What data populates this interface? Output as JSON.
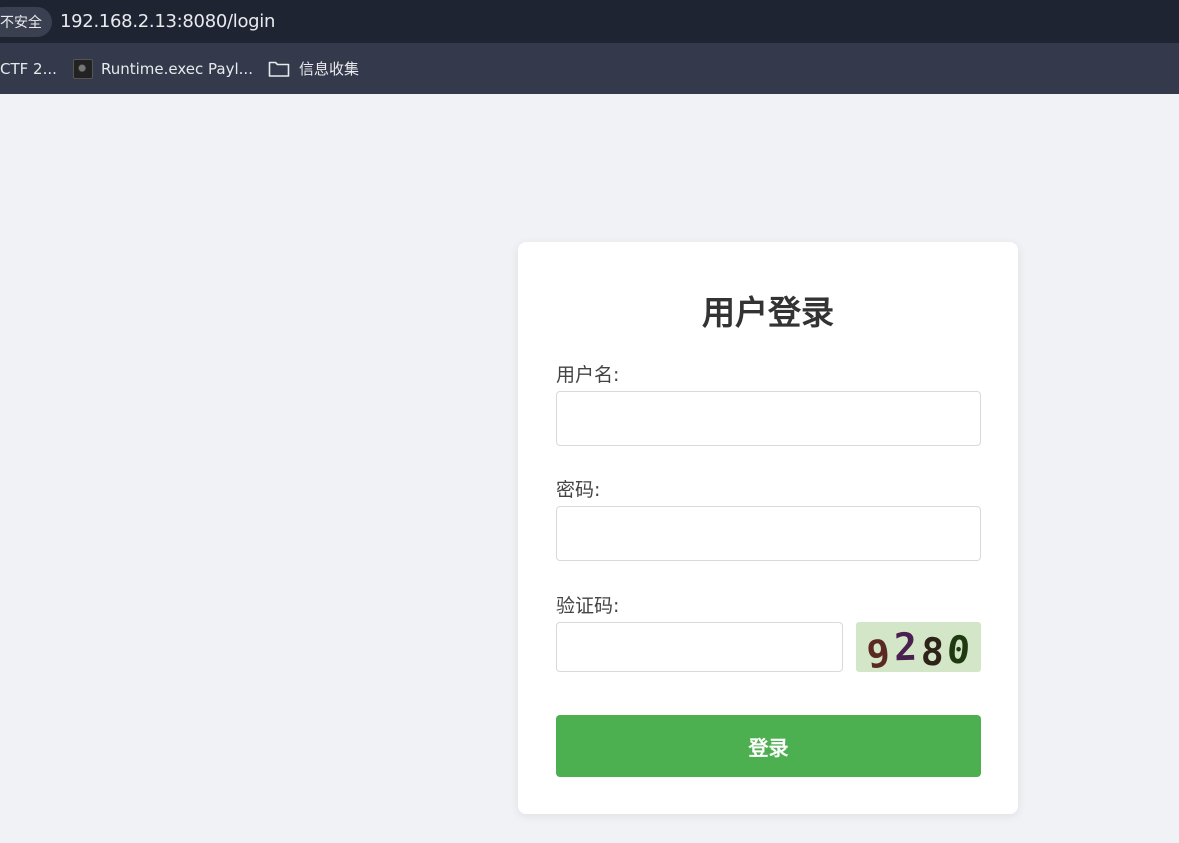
{
  "browser": {
    "security_label": "不安全",
    "url": "192.168.2.13:8080/login",
    "bookmarks": [
      {
        "label": "CTF 2...",
        "icon": "none"
      },
      {
        "label": "Runtime.exec Payl...",
        "icon": "site-favicon"
      },
      {
        "label": "信息收集",
        "icon": "folder-icon"
      }
    ]
  },
  "login": {
    "title": "用户登录",
    "username_label": "用户名:",
    "username_value": "",
    "password_label": "密码:",
    "password_value": "",
    "captcha_label": "验证码:",
    "captcha_value": "",
    "captcha_digits": [
      {
        "char": "9",
        "color": "#5a2a22"
      },
      {
        "char": "2",
        "color": "#4a2050"
      },
      {
        "char": "8",
        "color": "#2e2318"
      },
      {
        "char": "0",
        "color": "#1f3a10"
      }
    ],
    "submit_label": "登录"
  },
  "colors": {
    "page_bg": "#f0f2f5",
    "card_bg": "#ffffff",
    "button_bg": "#4caf50",
    "captcha_bg": "#d3e6c8",
    "toolbar_bg": "#1f2433",
    "bookmarks_bg": "#343a4b"
  }
}
